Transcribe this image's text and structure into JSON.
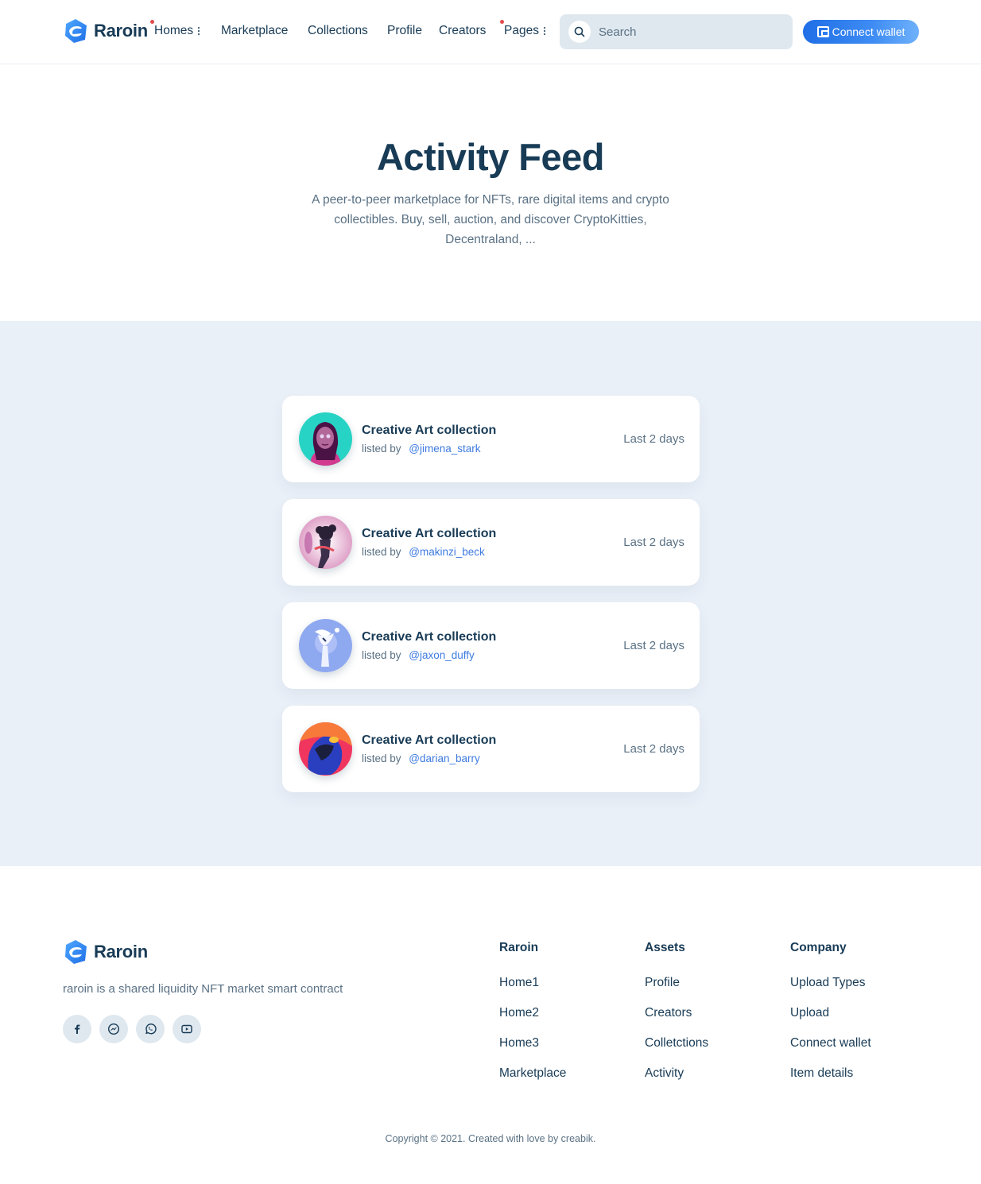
{
  "brand": {
    "name": "Raroin",
    "accent": "#2b7cf0",
    "dark": "#183b56",
    "muted": "#5a7184"
  },
  "nav": {
    "items": [
      {
        "label": "Homes",
        "has_dot": true,
        "has_menu": true
      },
      {
        "label": "Marketplace",
        "has_dot": false,
        "has_menu": false
      },
      {
        "label": "Collections",
        "has_dot": false,
        "has_menu": false
      },
      {
        "label": "Profile",
        "has_dot": false,
        "has_menu": false
      },
      {
        "label": "Creators",
        "has_dot": false,
        "has_menu": false
      },
      {
        "label": "Pages",
        "has_dot": true,
        "has_menu": true
      }
    ],
    "search_placeholder": "Search",
    "wallet_label": "Connect wallet"
  },
  "hero": {
    "title": "Activity Feed",
    "subtitle": "A peer-to-peer marketplace for NFTs, rare digital items and crypto collectibles. Buy, sell, auction, and discover CryptoKitties, Decentraland, ..."
  },
  "feed": [
    {
      "title": "Creative Art collection",
      "listed_by": "listed by",
      "user": "@jimena_stark",
      "time": "Last 2 days"
    },
    {
      "title": "Creative Art collection",
      "listed_by": "listed by",
      "user": "@makinzi_beck",
      "time": "Last 2 days"
    },
    {
      "title": "Creative Art collection",
      "listed_by": "listed by",
      "user": "@jaxon_duffy",
      "time": "Last 2 days"
    },
    {
      "title": "Creative Art collection",
      "listed_by": "listed by",
      "user": "@darian_barry",
      "time": "Last 2 days"
    }
  ],
  "footer": {
    "brand": "Raroin",
    "description": "raroin is a shared liquidity NFT market smart contract",
    "socials": [
      "facebook-icon",
      "messenger-icon",
      "whatsapp-icon",
      "youtube-icon"
    ],
    "columns": [
      {
        "title": "Raroin",
        "links": [
          "Home1",
          "Home2",
          "Home3",
          "Marketplace"
        ]
      },
      {
        "title": "Assets",
        "links": [
          "Profile",
          "Creators",
          "Colletctions",
          "Activity"
        ]
      },
      {
        "title": "Company",
        "links": [
          "Upload Types",
          "Upload",
          "Connect wallet",
          "Item details"
        ]
      }
    ],
    "copyright": "Copyright © 2021. Created with love by creabik."
  }
}
